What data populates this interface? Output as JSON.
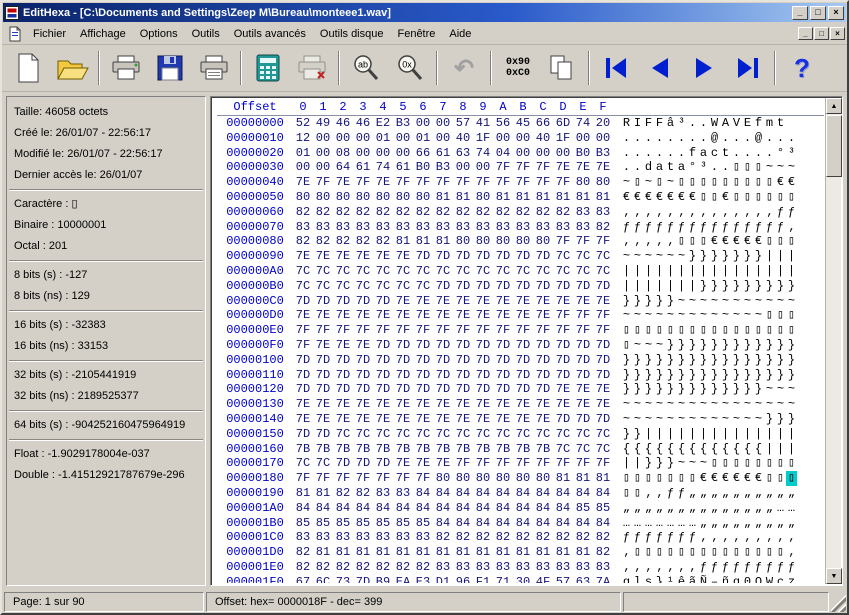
{
  "window": {
    "title": "EditHexa - [C:\\Documents and Settings\\Zeep M\\Bureau\\monteee1.wav]"
  },
  "icons": {
    "minimize": "_",
    "maximize": "□",
    "close": "×",
    "mdi_minimize": "_",
    "mdi_restore": "□",
    "mdi_close": "×",
    "undo": "↶",
    "help": "?",
    "scroll_up": "▲",
    "scroll_down": "▼"
  },
  "menu": {
    "items": [
      "Fichier",
      "Affichage",
      "Options",
      "Outils",
      "Outils avancés",
      "Outils disque",
      "Fenêtre",
      "Aide"
    ]
  },
  "toolbar": {
    "search_text_label": "ab",
    "search_hex_label": "0x",
    "goto_line1": "0x90",
    "goto_line2": "0xC0"
  },
  "info_panel": {
    "sections": [
      [
        "Taille: 46058 octets",
        "Créé le: 26/01/07 - 22:56:17",
        "Modifié le: 26/01/07 - 22:56:17",
        "Dernier accès le: 26/01/07"
      ],
      [
        "Caractère : ▯",
        "Binaire : 10000001",
        "Octal : 201"
      ],
      [
        "8 bits (s) : -127",
        "8 bits (ns) : 129"
      ],
      [
        "16 bits (s) : -32383",
        "16 bits (ns) : 33153"
      ],
      [
        "32 bits (s) : -2105441919",
        "32 bits (ns) : 2189525377"
      ],
      [
        "64 bits (s) : -904252160475964919"
      ],
      [
        "Float : -1.9029178004e-037",
        "Double : -1.41512921787679e-296"
      ]
    ]
  },
  "hex_view": {
    "header_label": "Offset",
    "columns": [
      "0",
      "1",
      "2",
      "3",
      "4",
      "5",
      "6",
      "7",
      "8",
      "9",
      "A",
      "B",
      "C",
      "D",
      "E",
      "F"
    ],
    "cursor": {
      "row": 24,
      "col": 15
    },
    "rows": [
      {
        "offset": "00000000",
        "bytes": [
          "52",
          "49",
          "46",
          "46",
          "E2",
          "B3",
          "00",
          "00",
          "57",
          "41",
          "56",
          "45",
          "66",
          "6D",
          "74",
          "20"
        ]
      },
      {
        "offset": "00000010",
        "bytes": [
          "12",
          "00",
          "00",
          "00",
          "01",
          "00",
          "01",
          "00",
          "40",
          "1F",
          "00",
          "00",
          "40",
          "1F",
          "00",
          "00"
        ]
      },
      {
        "offset": "00000020",
        "bytes": [
          "01",
          "00",
          "08",
          "00",
          "00",
          "00",
          "66",
          "61",
          "63",
          "74",
          "04",
          "00",
          "00",
          "00",
          "B0",
          "B3"
        ]
      },
      {
        "offset": "00000030",
        "bytes": [
          "00",
          "00",
          "64",
          "61",
          "74",
          "61",
          "B0",
          "B3",
          "00",
          "00",
          "7F",
          "7F",
          "7F",
          "7E",
          "7E",
          "7E"
        ]
      },
      {
        "offset": "00000040",
        "bytes": [
          "7E",
          "7F",
          "7E",
          "7F",
          "7E",
          "7F",
          "7F",
          "7F",
          "7F",
          "7F",
          "7F",
          "7F",
          "7F",
          "7F",
          "80",
          "80"
        ]
      },
      {
        "offset": "00000050",
        "bytes": [
          "80",
          "80",
          "80",
          "80",
          "80",
          "80",
          "80",
          "81",
          "81",
          "80",
          "81",
          "81",
          "81",
          "81",
          "81",
          "81"
        ]
      },
      {
        "offset": "00000060",
        "bytes": [
          "82",
          "82",
          "82",
          "82",
          "82",
          "82",
          "82",
          "82",
          "82",
          "82",
          "82",
          "82",
          "82",
          "82",
          "83",
          "83"
        ]
      },
      {
        "offset": "00000070",
        "bytes": [
          "83",
          "83",
          "83",
          "83",
          "83",
          "83",
          "83",
          "83",
          "83",
          "83",
          "83",
          "83",
          "83",
          "83",
          "83",
          "82"
        ]
      },
      {
        "offset": "00000080",
        "bytes": [
          "82",
          "82",
          "82",
          "82",
          "82",
          "81",
          "81",
          "81",
          "80",
          "80",
          "80",
          "80",
          "80",
          "7F",
          "7F",
          "7F"
        ]
      },
      {
        "offset": "00000090",
        "bytes": [
          "7E",
          "7E",
          "7E",
          "7E",
          "7E",
          "7E",
          "7D",
          "7D",
          "7D",
          "7D",
          "7D",
          "7D",
          "7D",
          "7C",
          "7C",
          "7C"
        ]
      },
      {
        "offset": "000000A0",
        "bytes": [
          "7C",
          "7C",
          "7C",
          "7C",
          "7C",
          "7C",
          "7C",
          "7C",
          "7C",
          "7C",
          "7C",
          "7C",
          "7C",
          "7C",
          "7C",
          "7C"
        ]
      },
      {
        "offset": "000000B0",
        "bytes": [
          "7C",
          "7C",
          "7C",
          "7C",
          "7C",
          "7C",
          "7C",
          "7D",
          "7D",
          "7D",
          "7D",
          "7D",
          "7D",
          "7D",
          "7D",
          "7D"
        ]
      },
      {
        "offset": "000000C0",
        "bytes": [
          "7D",
          "7D",
          "7D",
          "7D",
          "7D",
          "7E",
          "7E",
          "7E",
          "7E",
          "7E",
          "7E",
          "7E",
          "7E",
          "7E",
          "7E",
          "7E"
        ]
      },
      {
        "offset": "000000D0",
        "bytes": [
          "7E",
          "7E",
          "7E",
          "7E",
          "7E",
          "7E",
          "7E",
          "7E",
          "7E",
          "7E",
          "7E",
          "7E",
          "7E",
          "7F",
          "7F",
          "7F"
        ]
      },
      {
        "offset": "000000E0",
        "bytes": [
          "7F",
          "7F",
          "7F",
          "7F",
          "7F",
          "7F",
          "7F",
          "7F",
          "7F",
          "7F",
          "7F",
          "7F",
          "7F",
          "7F",
          "7F",
          "7F"
        ]
      },
      {
        "offset": "000000F0",
        "bytes": [
          "7F",
          "7E",
          "7E",
          "7E",
          "7D",
          "7D",
          "7D",
          "7D",
          "7D",
          "7D",
          "7D",
          "7D",
          "7D",
          "7D",
          "7D",
          "7D"
        ]
      },
      {
        "offset": "00000100",
        "bytes": [
          "7D",
          "7D",
          "7D",
          "7D",
          "7D",
          "7D",
          "7D",
          "7D",
          "7D",
          "7D",
          "7D",
          "7D",
          "7D",
          "7D",
          "7D",
          "7D"
        ]
      },
      {
        "offset": "00000110",
        "bytes": [
          "7D",
          "7D",
          "7D",
          "7D",
          "7D",
          "7D",
          "7D",
          "7D",
          "7D",
          "7D",
          "7D",
          "7D",
          "7D",
          "7D",
          "7D",
          "7D"
        ]
      },
      {
        "offset": "00000120",
        "bytes": [
          "7D",
          "7D",
          "7D",
          "7D",
          "7D",
          "7D",
          "7D",
          "7D",
          "7D",
          "7D",
          "7D",
          "7D",
          "7D",
          "7E",
          "7E",
          "7E"
        ]
      },
      {
        "offset": "00000130",
        "bytes": [
          "7E",
          "7E",
          "7E",
          "7E",
          "7E",
          "7E",
          "7E",
          "7E",
          "7E",
          "7E",
          "7E",
          "7E",
          "7E",
          "7E",
          "7E",
          "7E"
        ]
      },
      {
        "offset": "00000140",
        "bytes": [
          "7E",
          "7E",
          "7E",
          "7E",
          "7E",
          "7E",
          "7E",
          "7E",
          "7E",
          "7E",
          "7E",
          "7E",
          "7E",
          "7D",
          "7D",
          "7D"
        ]
      },
      {
        "offset": "00000150",
        "bytes": [
          "7D",
          "7D",
          "7C",
          "7C",
          "7C",
          "7C",
          "7C",
          "7C",
          "7C",
          "7C",
          "7C",
          "7C",
          "7C",
          "7C",
          "7C",
          "7C"
        ]
      },
      {
        "offset": "00000160",
        "bytes": [
          "7B",
          "7B",
          "7B",
          "7B",
          "7B",
          "7B",
          "7B",
          "7B",
          "7B",
          "7B",
          "7B",
          "7B",
          "7B",
          "7C",
          "7C",
          "7C"
        ]
      },
      {
        "offset": "00000170",
        "bytes": [
          "7C",
          "7C",
          "7D",
          "7D",
          "7D",
          "7E",
          "7E",
          "7E",
          "7F",
          "7F",
          "7F",
          "7F",
          "7F",
          "7F",
          "7F",
          "7F"
        ]
      },
      {
        "offset": "00000180",
        "bytes": [
          "7F",
          "7F",
          "7F",
          "7F",
          "7F",
          "7F",
          "7F",
          "80",
          "80",
          "80",
          "80",
          "80",
          "80",
          "81",
          "81",
          "81"
        ]
      },
      {
        "offset": "00000190",
        "bytes": [
          "81",
          "81",
          "82",
          "82",
          "83",
          "83",
          "84",
          "84",
          "84",
          "84",
          "84",
          "84",
          "84",
          "84",
          "84",
          "84"
        ]
      },
      {
        "offset": "000001A0",
        "bytes": [
          "84",
          "84",
          "84",
          "84",
          "84",
          "84",
          "84",
          "84",
          "84",
          "84",
          "84",
          "84",
          "84",
          "84",
          "85",
          "85"
        ]
      },
      {
        "offset": "000001B0",
        "bytes": [
          "85",
          "85",
          "85",
          "85",
          "85",
          "85",
          "85",
          "84",
          "84",
          "84",
          "84",
          "84",
          "84",
          "84",
          "84",
          "84"
        ]
      },
      {
        "offset": "000001C0",
        "bytes": [
          "83",
          "83",
          "83",
          "83",
          "83",
          "83",
          "83",
          "82",
          "82",
          "82",
          "82",
          "82",
          "82",
          "82",
          "82",
          "82"
        ]
      },
      {
        "offset": "000001D0",
        "bytes": [
          "82",
          "81",
          "81",
          "81",
          "81",
          "81",
          "81",
          "81",
          "81",
          "81",
          "81",
          "81",
          "81",
          "81",
          "81",
          "82"
        ]
      },
      {
        "offset": "000001E0",
        "bytes": [
          "82",
          "82",
          "82",
          "82",
          "82",
          "82",
          "82",
          "83",
          "83",
          "83",
          "83",
          "83",
          "83",
          "83",
          "83",
          "83"
        ]
      },
      {
        "offset": "000001F0",
        "bytes": [
          "67",
          "6C",
          "73",
          "7D",
          "B9",
          "EA",
          "E3",
          "D1",
          "96",
          "F1",
          "71",
          "30",
          "4F",
          "57",
          "63",
          "7A"
        ]
      }
    ]
  },
  "status_bar": {
    "page": "Page: 1 sur 90",
    "offset": "Offset: hex= 0000018F - dec= 399"
  }
}
